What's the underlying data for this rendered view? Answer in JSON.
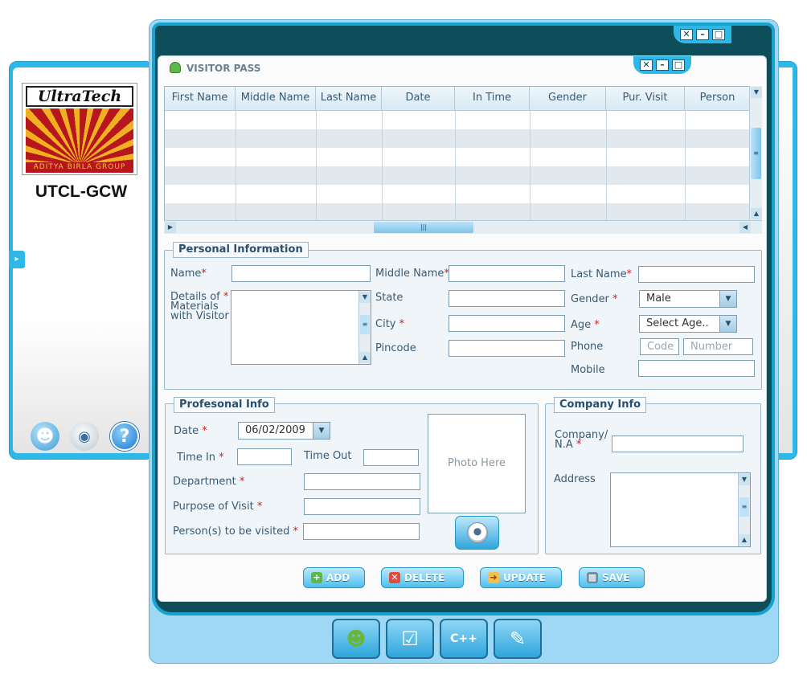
{
  "window": {
    "title": "VISITOR PASS"
  },
  "left_panel": {
    "logo_brand": "UltraTech",
    "logo_group": "ADITYA BIRLA GROUP",
    "org_name": "UTCL-GCW",
    "icons": [
      "user-icon",
      "webcam-icon",
      "help-icon"
    ]
  },
  "grid": {
    "columns": [
      "First Name",
      "Middle Name",
      "Last Name",
      "Date",
      "In Time",
      "Gender",
      "Pur. Visit",
      "Person"
    ],
    "rows": []
  },
  "personal_info": {
    "legend": "Personal Information",
    "name_label": "Name",
    "middle_name_label": "Middle Name",
    "last_name_label": "Last Name",
    "materials_label_1": "Details of",
    "materials_label_2": "Materials",
    "materials_label_3": "with Visitor",
    "state_label": "State",
    "city_label": "City",
    "pincode_label": "Pincode",
    "gender_label": "Gender",
    "gender_value": "Male",
    "age_label": "Age",
    "age_value": "Select Age..",
    "phone_label": "Phone",
    "phone_code_placeholder": "Code",
    "phone_number_placeholder": "Number",
    "mobile_label": "Mobile"
  },
  "professional_info": {
    "legend": "Profesonal Info",
    "date_label": "Date",
    "date_value": "06/02/2009",
    "time_in_label": "Time In",
    "time_out_label": "Time Out",
    "department_label": "Department",
    "purpose_label": "Purpose of Visit",
    "person_label": "Person(s) to be visited",
    "photo_placeholder": "Photo Here"
  },
  "company_info": {
    "legend": "Company Info",
    "company_label_1": "Company/",
    "company_label_2": "N.A",
    "address_label": "Address"
  },
  "required_mark": "*",
  "actions": {
    "add": "ADD",
    "delete": "DELETE",
    "update": "UPDATE",
    "save": "SAVE"
  },
  "dock": [
    "visitors-icon",
    "checklist-icon",
    "code-search-icon",
    "edit-document-icon"
  ],
  "colors": {
    "accent": "#2eb8e8",
    "dark_frame": "#0e4d5a",
    "required": "#cc2222"
  }
}
